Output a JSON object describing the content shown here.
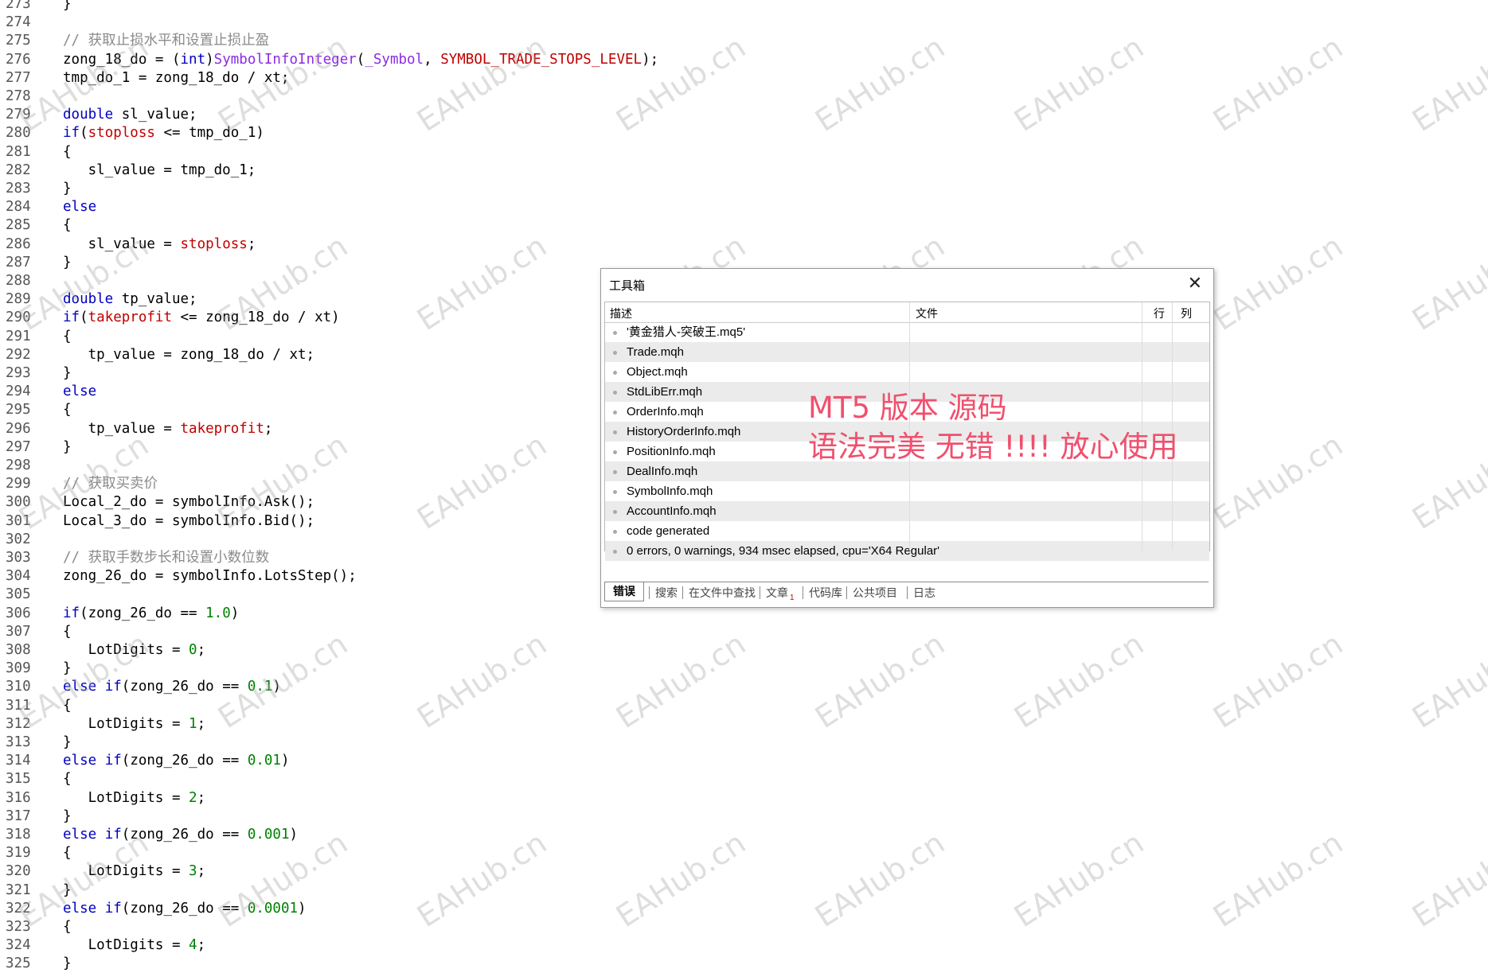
{
  "editor": {
    "lines": [
      {
        "n": "273",
        "code": [
          {
            "t": "}",
            "c": "p"
          }
        ]
      },
      {
        "n": "274",
        "code": []
      },
      {
        "n": "275",
        "code": [
          {
            "t": "// 获取止损水平和设置止损止盈",
            "c": "comment"
          }
        ]
      },
      {
        "n": "276",
        "code": [
          {
            "t": "zong_18_do = (",
            "c": "p"
          },
          {
            "t": "int",
            "c": "kw"
          },
          {
            "t": ")",
            "c": "p"
          },
          {
            "t": "SymbolInfoInteger",
            "c": "fn"
          },
          {
            "t": "(",
            "c": "p"
          },
          {
            "t": "_Symbol",
            "c": "fn"
          },
          {
            "t": ", ",
            "c": "p"
          },
          {
            "t": "SYMBOL_TRADE_STOPS_LEVEL",
            "c": "var"
          },
          {
            "t": ");",
            "c": "p"
          }
        ]
      },
      {
        "n": "277",
        "code": [
          {
            "t": "tmp_do_1 = zong_18_do / xt;",
            "c": "p"
          }
        ]
      },
      {
        "n": "278",
        "code": []
      },
      {
        "n": "279",
        "code": [
          {
            "t": "double",
            "c": "kw"
          },
          {
            "t": " sl_value;",
            "c": "p"
          }
        ]
      },
      {
        "n": "280",
        "code": [
          {
            "t": "if",
            "c": "kw"
          },
          {
            "t": "(",
            "c": "p"
          },
          {
            "t": "stoploss",
            "c": "var"
          },
          {
            "t": " <= tmp_do_1)",
            "c": "p"
          }
        ]
      },
      {
        "n": "281",
        "code": [
          {
            "t": "{",
            "c": "p"
          }
        ]
      },
      {
        "n": "282",
        "code": [
          {
            "t": "   sl_value = tmp_do_1;",
            "c": "p"
          }
        ]
      },
      {
        "n": "283",
        "code": [
          {
            "t": "}",
            "c": "p"
          }
        ]
      },
      {
        "n": "284",
        "code": [
          {
            "t": "else",
            "c": "kw"
          }
        ]
      },
      {
        "n": "285",
        "code": [
          {
            "t": "{",
            "c": "p"
          }
        ]
      },
      {
        "n": "286",
        "code": [
          {
            "t": "   sl_value = ",
            "c": "p"
          },
          {
            "t": "stoploss",
            "c": "var"
          },
          {
            "t": ";",
            "c": "p"
          }
        ]
      },
      {
        "n": "287",
        "code": [
          {
            "t": "}",
            "c": "p"
          }
        ]
      },
      {
        "n": "288",
        "code": []
      },
      {
        "n": "289",
        "code": [
          {
            "t": "double",
            "c": "kw"
          },
          {
            "t": " tp_value;",
            "c": "p"
          }
        ]
      },
      {
        "n": "290",
        "code": [
          {
            "t": "if",
            "c": "kw"
          },
          {
            "t": "(",
            "c": "p"
          },
          {
            "t": "takeprofit",
            "c": "var"
          },
          {
            "t": " <= zong_18_do / xt)",
            "c": "p"
          }
        ]
      },
      {
        "n": "291",
        "code": [
          {
            "t": "{",
            "c": "p"
          }
        ]
      },
      {
        "n": "292",
        "code": [
          {
            "t": "   tp_value = zong_18_do / xt;",
            "c": "p"
          }
        ]
      },
      {
        "n": "293",
        "code": [
          {
            "t": "}",
            "c": "p"
          }
        ]
      },
      {
        "n": "294",
        "code": [
          {
            "t": "else",
            "c": "kw"
          }
        ]
      },
      {
        "n": "295",
        "code": [
          {
            "t": "{",
            "c": "p"
          }
        ]
      },
      {
        "n": "296",
        "code": [
          {
            "t": "   tp_value = ",
            "c": "p"
          },
          {
            "t": "takeprofit",
            "c": "var"
          },
          {
            "t": ";",
            "c": "p"
          }
        ]
      },
      {
        "n": "297",
        "code": [
          {
            "t": "}",
            "c": "p"
          }
        ]
      },
      {
        "n": "298",
        "code": []
      },
      {
        "n": "299",
        "code": [
          {
            "t": "// 获取买卖价",
            "c": "comment"
          }
        ]
      },
      {
        "n": "300",
        "code": [
          {
            "t": "Local_2_do = symbolInfo.Ask();",
            "c": "p"
          }
        ]
      },
      {
        "n": "301",
        "code": [
          {
            "t": "Local_3_do = symbolInfo.Bid();",
            "c": "p"
          }
        ]
      },
      {
        "n": "302",
        "code": []
      },
      {
        "n": "303",
        "code": [
          {
            "t": "// 获取手数步长和设置小数位数",
            "c": "comment"
          }
        ]
      },
      {
        "n": "304",
        "code": [
          {
            "t": "zong_26_do = symbolInfo.LotsStep();",
            "c": "p"
          }
        ]
      },
      {
        "n": "305",
        "code": []
      },
      {
        "n": "306",
        "code": [
          {
            "t": "if",
            "c": "kw"
          },
          {
            "t": "(zong_26_do == ",
            "c": "p"
          },
          {
            "t": "1.0",
            "c": "num"
          },
          {
            "t": ")",
            "c": "p"
          }
        ]
      },
      {
        "n": "307",
        "code": [
          {
            "t": "{",
            "c": "p"
          }
        ]
      },
      {
        "n": "308",
        "code": [
          {
            "t": "   LotDigits = ",
            "c": "p"
          },
          {
            "t": "0",
            "c": "num"
          },
          {
            "t": ";",
            "c": "p"
          }
        ]
      },
      {
        "n": "309",
        "code": [
          {
            "t": "}",
            "c": "p"
          }
        ]
      },
      {
        "n": "310",
        "code": [
          {
            "t": "else",
            "c": "kw"
          },
          {
            "t": " ",
            "c": "p"
          },
          {
            "t": "if",
            "c": "kw"
          },
          {
            "t": "(zong_26_do == ",
            "c": "p"
          },
          {
            "t": "0.1",
            "c": "num"
          },
          {
            "t": ")",
            "c": "p"
          }
        ]
      },
      {
        "n": "311",
        "code": [
          {
            "t": "{",
            "c": "p"
          }
        ]
      },
      {
        "n": "312",
        "code": [
          {
            "t": "   LotDigits = ",
            "c": "p"
          },
          {
            "t": "1",
            "c": "num"
          },
          {
            "t": ";",
            "c": "p"
          }
        ]
      },
      {
        "n": "313",
        "code": [
          {
            "t": "}",
            "c": "p"
          }
        ]
      },
      {
        "n": "314",
        "code": [
          {
            "t": "else",
            "c": "kw"
          },
          {
            "t": " ",
            "c": "p"
          },
          {
            "t": "if",
            "c": "kw"
          },
          {
            "t": "(zong_26_do == ",
            "c": "p"
          },
          {
            "t": "0.01",
            "c": "num"
          },
          {
            "t": ")",
            "c": "p"
          }
        ]
      },
      {
        "n": "315",
        "code": [
          {
            "t": "{",
            "c": "p"
          }
        ]
      },
      {
        "n": "316",
        "code": [
          {
            "t": "   LotDigits = ",
            "c": "p"
          },
          {
            "t": "2",
            "c": "num"
          },
          {
            "t": ";",
            "c": "p"
          }
        ]
      },
      {
        "n": "317",
        "code": [
          {
            "t": "}",
            "c": "p"
          }
        ]
      },
      {
        "n": "318",
        "code": [
          {
            "t": "else",
            "c": "kw"
          },
          {
            "t": " ",
            "c": "p"
          },
          {
            "t": "if",
            "c": "kw"
          },
          {
            "t": "(zong_26_do == ",
            "c": "p"
          },
          {
            "t": "0.001",
            "c": "num"
          },
          {
            "t": ")",
            "c": "p"
          }
        ]
      },
      {
        "n": "319",
        "code": [
          {
            "t": "{",
            "c": "p"
          }
        ]
      },
      {
        "n": "320",
        "code": [
          {
            "t": "   LotDigits = ",
            "c": "p"
          },
          {
            "t": "3",
            "c": "num"
          },
          {
            "t": ";",
            "c": "p"
          }
        ]
      },
      {
        "n": "321",
        "code": [
          {
            "t": "}",
            "c": "p"
          }
        ]
      },
      {
        "n": "322",
        "code": [
          {
            "t": "else",
            "c": "kw"
          },
          {
            "t": " ",
            "c": "p"
          },
          {
            "t": "if",
            "c": "kw"
          },
          {
            "t": "(zong_26_do == ",
            "c": "p"
          },
          {
            "t": "0.0001",
            "c": "num"
          },
          {
            "t": ")",
            "c": "p"
          }
        ]
      },
      {
        "n": "323",
        "code": [
          {
            "t": "{",
            "c": "p"
          }
        ]
      },
      {
        "n": "324",
        "code": [
          {
            "t": "   LotDigits = ",
            "c": "p"
          },
          {
            "t": "4",
            "c": "num"
          },
          {
            "t": ";",
            "c": "p"
          }
        ]
      },
      {
        "n": "325",
        "code": [
          {
            "t": "}",
            "c": "p"
          }
        ]
      }
    ]
  },
  "watermark": {
    "text": "EAHub.cn"
  },
  "toolbox": {
    "title": "工具箱",
    "close_icon": "close-icon",
    "columns": {
      "desc": "描述",
      "file": "文件",
      "row": "行",
      "col": "列"
    },
    "rows": [
      "'黄金猎人-突破王.mq5'",
      "Trade.mqh",
      "Object.mqh",
      "StdLibErr.mqh",
      "OrderInfo.mqh",
      "HistoryOrderInfo.mqh",
      "PositionInfo.mqh",
      "DealInfo.mqh",
      "SymbolInfo.mqh",
      "AccountInfo.mqh",
      "code generated",
      "0 errors, 0 warnings, 934 msec elapsed, cpu='X64 Regular'"
    ],
    "tabs": [
      "错误",
      "搜索",
      "在文件中查找",
      "文章",
      "代码库",
      "公共项目",
      "日志"
    ],
    "tab_badge": "1"
  },
  "annotation": {
    "line1": "MT5 版本 源码",
    "line2": "语法完美 无错 !!!! 放心使用",
    "color": "#f0506e"
  },
  "colors": {
    "keyword": "#0000c0",
    "function": "#8a2be2",
    "variable": "#c00000",
    "number": "#008000",
    "comment": "#8a8a8a"
  }
}
